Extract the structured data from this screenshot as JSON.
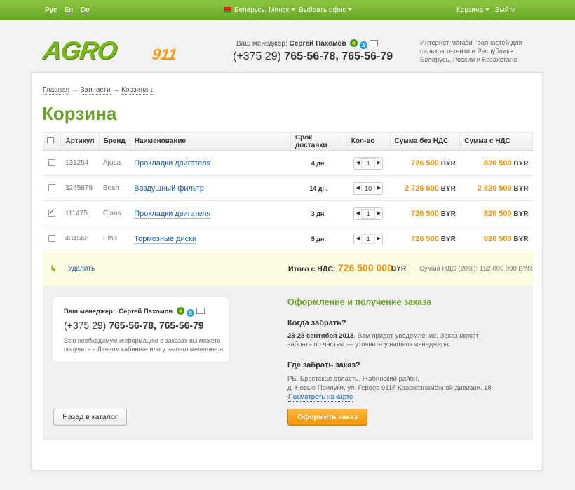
{
  "topbar": {
    "lang_ru": "Рус",
    "lang_en": "En",
    "lang_de": "De",
    "region": "Беларусь, Минск",
    "office": "Выбрать офис",
    "cart": "Корзина",
    "logout": "Выйти"
  },
  "header": {
    "logo_main": "AGRO",
    "logo_num": "911",
    "manager_label": "Ваш менеджер:",
    "manager_name": "Сергей Пахомов",
    "phone_code": "(+375 29)",
    "phone_numbers": "765-56-78, 765-56-79",
    "tagline": "Интернет-магазин запчастей для сельхоз техники в Республике Беларусь, России и Казахстане"
  },
  "breadcrumb": {
    "home": "Главная",
    "sep1": "→",
    "parts": "Запчасти",
    "sep2": "→",
    "current": "Корзина ↓"
  },
  "page_title": "Корзина",
  "table": {
    "headers": {
      "article": "Артикул",
      "brand": "Бренд",
      "name": "Наименование",
      "delivery": "Срок доставки",
      "qty": "Кол-во",
      "sum_no_vat": "Сумма без НДС",
      "sum_vat": "Сумма с НДС"
    },
    "rows": [
      {
        "article": "131254",
        "brand": "Ajusa",
        "name": "Прокладки двигателя",
        "delivery": "4 дн.",
        "qty": "1",
        "sum_no_vat": "726 500",
        "sum_vat": "820 500",
        "currency": "BYR",
        "checked": false
      },
      {
        "article": "3245879",
        "brand": "Bosh",
        "name": "Воздушный фильтр",
        "delivery": "14 дн.",
        "qty": "10",
        "sum_no_vat": "2 726 500",
        "sum_vat": "2 820 500",
        "currency": "BYR",
        "checked": false
      },
      {
        "article": "111475",
        "brand": "Claas",
        "name": "Прокладки двигателя",
        "delivery": "3 дн.",
        "qty": "1",
        "sum_no_vat": "726 500",
        "sum_vat": "820 500",
        "currency": "BYR",
        "checked": true
      },
      {
        "article": "434568",
        "brand": "Elho",
        "name": "Тормозные диски",
        "delivery": "5 дн.",
        "qty": "1",
        "sum_no_vat": "726 500",
        "sum_vat": "820 500",
        "currency": "BYR",
        "checked": false
      }
    ]
  },
  "totals": {
    "delete": "Удалить",
    "label": "Итого с НДС:",
    "value": "726 500 000",
    "currency": "BYR",
    "vat_note": "Сумма НДС (20%): 152 000 000 BYR"
  },
  "manager_card": {
    "label": "Ваш менеджер:",
    "name": "Сергей Пахомов",
    "phone_code": "(+375 29)",
    "phone_numbers": "765-56-78, 765-56-79",
    "note": "Всю необходимую информацию о заказах вы можете получить в Личном кабинете или у вашего менеджера."
  },
  "back_button": "Назад в каталог",
  "order": {
    "title": "Оформление и получение заказа",
    "when_heading": "Когда забрать?",
    "when_date": "23-28 сентября 2013",
    "when_text": ". Вам придет уведомление. Заказ может забрать по частям — уточните у вашего менеджера.",
    "where_heading": "Где забрать заказ?",
    "address_line1": "РБ, Брестская область, Жабинский район,",
    "address_line2": "д. Новые Прилуки, ул. Героев 911й Краснознамённой дивизии, 18",
    "map_link": "Посмотреть на карте",
    "submit": "Оформить заказ"
  },
  "colors": {
    "brand_green": "#6ba22b",
    "accent_orange": "#f39106",
    "link_blue": "#1a5fa8"
  }
}
